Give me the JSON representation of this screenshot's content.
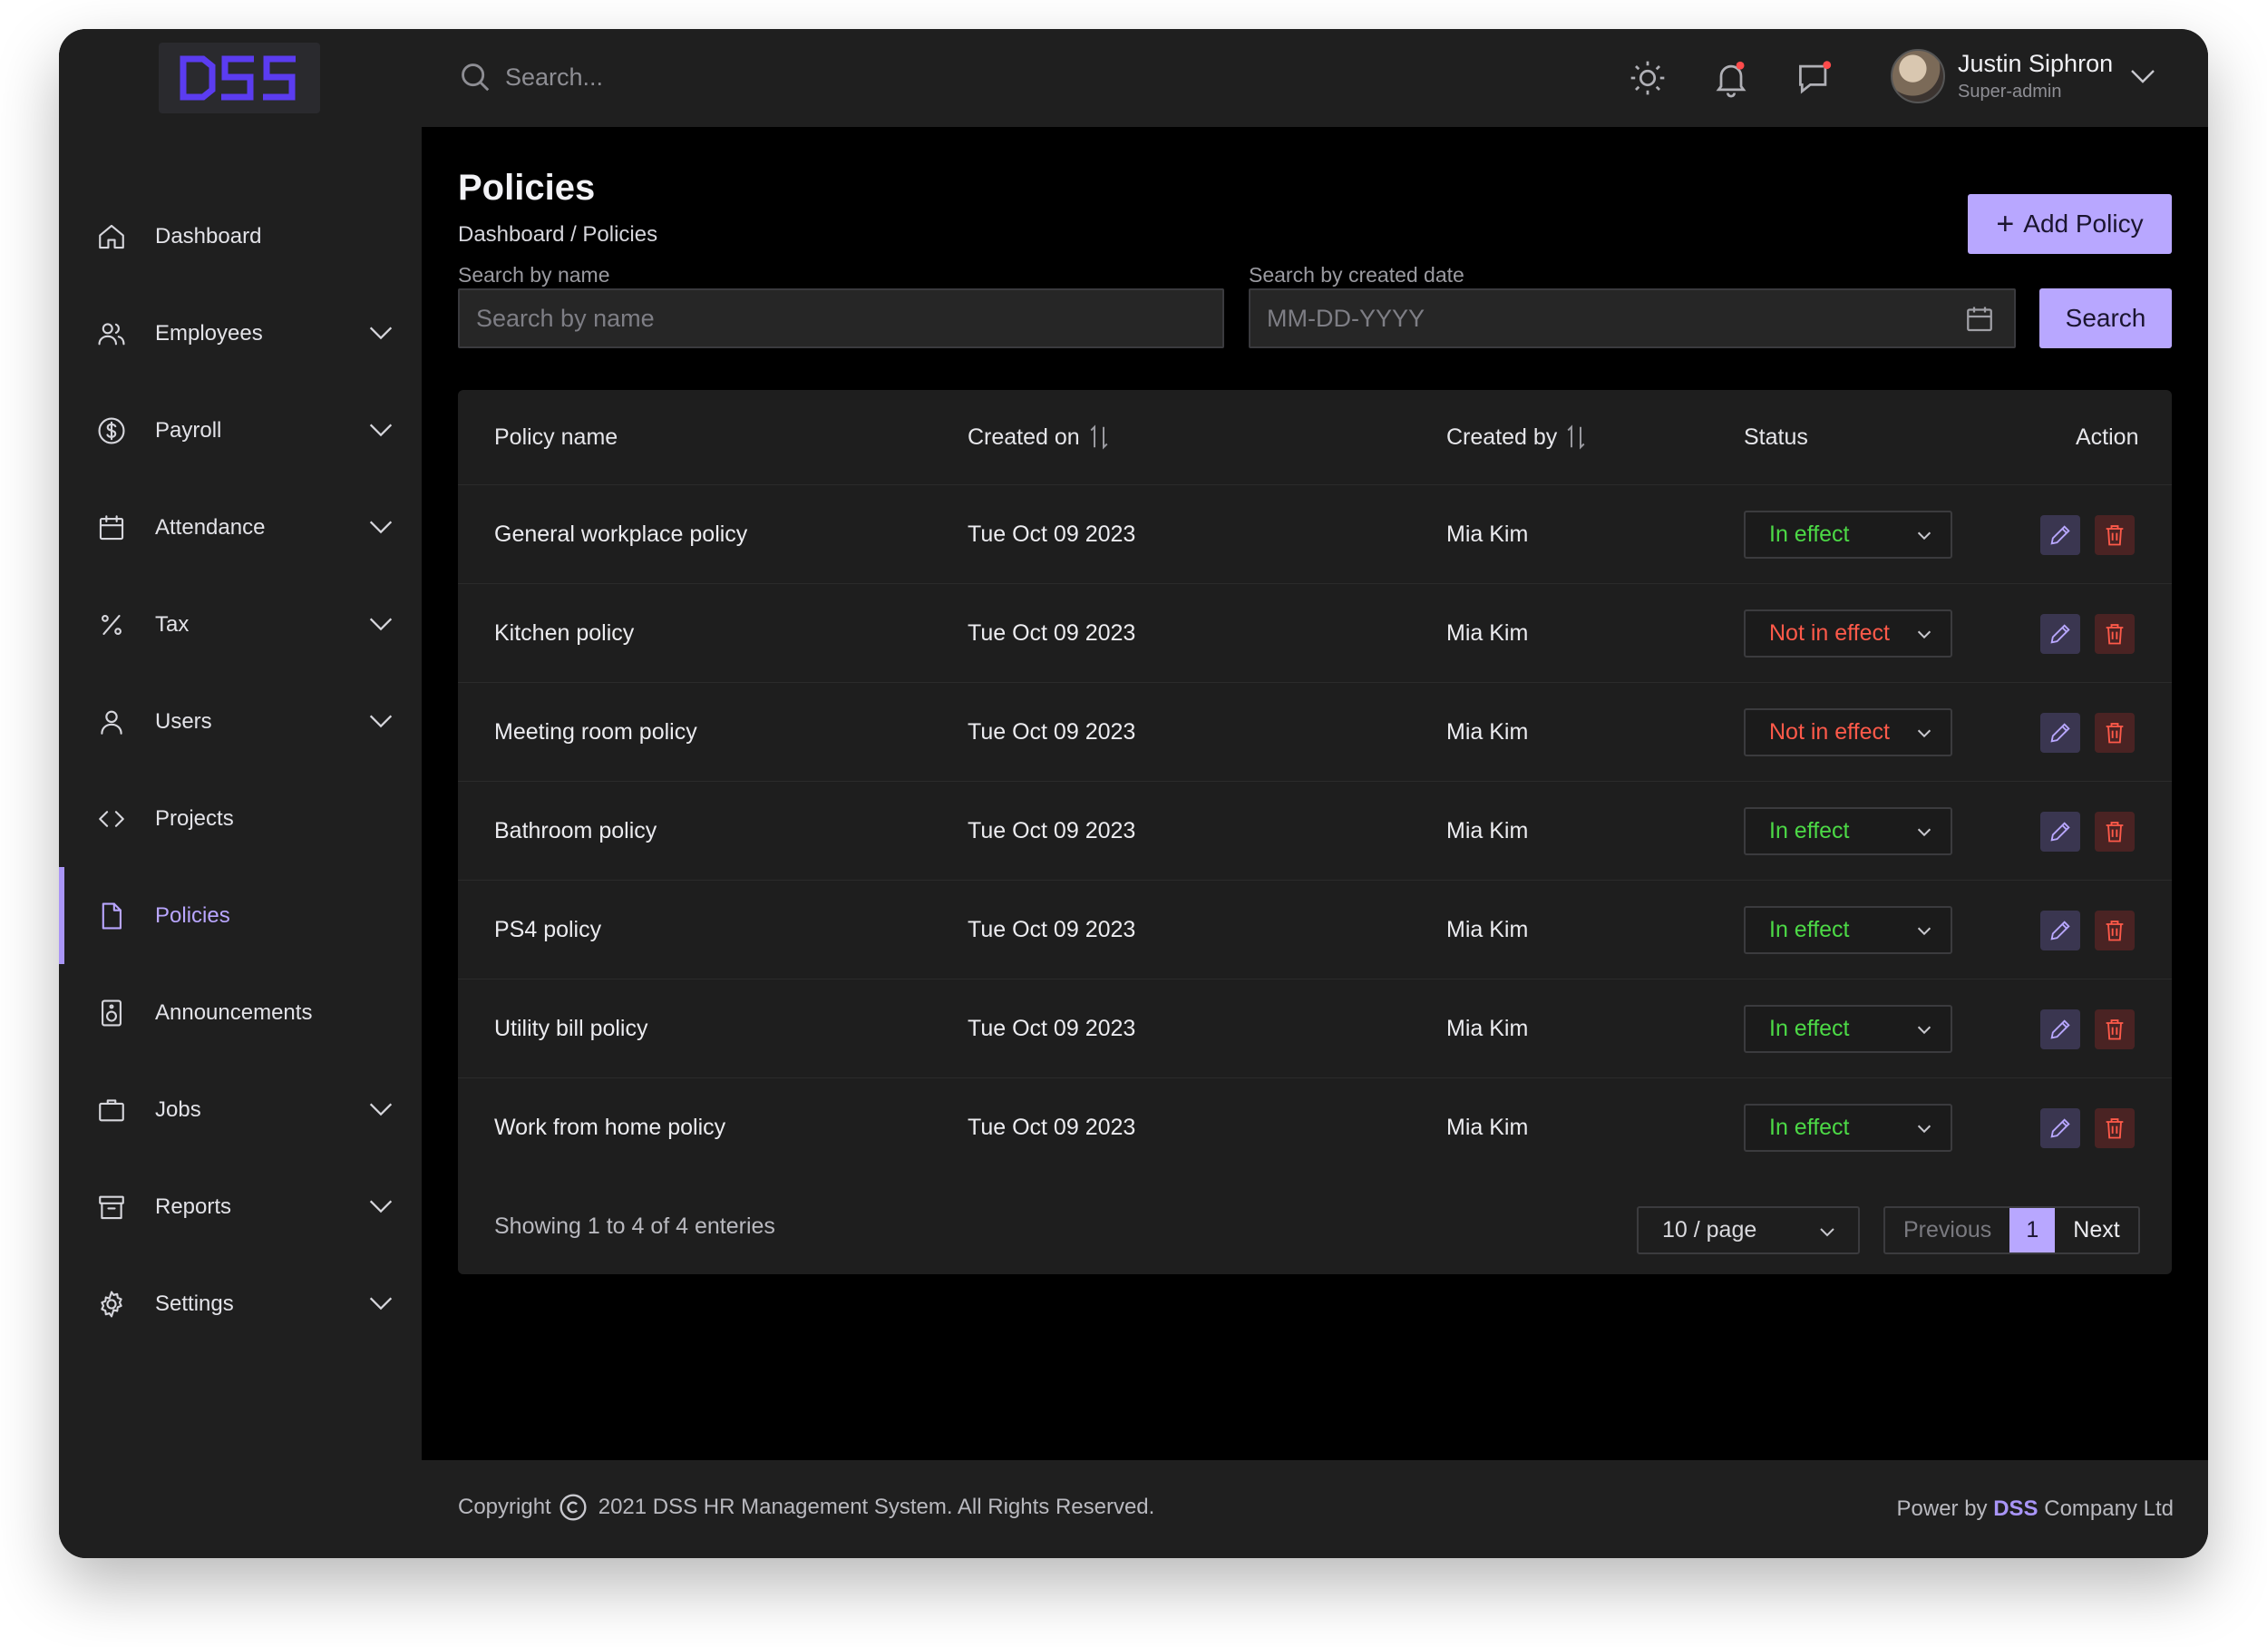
{
  "brand": {
    "logo_text": "DSS"
  },
  "sidebar": {
    "items": [
      {
        "label": "Dashboard",
        "icon": "home-icon",
        "expandable": false
      },
      {
        "label": "Employees",
        "icon": "users-icon",
        "expandable": true
      },
      {
        "label": "Payroll",
        "icon": "dollar-icon",
        "expandable": true
      },
      {
        "label": "Attendance",
        "icon": "calendar-icon",
        "expandable": true
      },
      {
        "label": "Tax",
        "icon": "percent-icon",
        "expandable": true
      },
      {
        "label": "Users",
        "icon": "user-icon",
        "expandable": true
      },
      {
        "label": "Projects",
        "icon": "code-icon",
        "expandable": false
      },
      {
        "label": "Policies",
        "icon": "file-icon",
        "expandable": false,
        "active": true
      },
      {
        "label": "Announcements",
        "icon": "speaker-icon",
        "expandable": false
      },
      {
        "label": "Jobs",
        "icon": "briefcase-icon",
        "expandable": true
      },
      {
        "label": "Reports",
        "icon": "archive-icon",
        "expandable": true
      },
      {
        "label": "Settings",
        "icon": "gear-icon",
        "expandable": true
      }
    ]
  },
  "header": {
    "search_placeholder": "Search...",
    "user": {
      "name": "Justin Siphron",
      "role": "Super-admin"
    }
  },
  "page": {
    "title": "Policies",
    "breadcrumb": "Dashboard / Policies",
    "add_button": "Add Policy"
  },
  "filters": {
    "name_label": "Search by name",
    "name_placeholder": "Search by name",
    "date_label": "Search by created date",
    "date_placeholder": "MM-DD-YYYY",
    "search_button": "Search"
  },
  "table": {
    "columns": [
      "Policy name",
      "Created on",
      "Created by",
      "Status",
      "Action"
    ],
    "rows": [
      {
        "name": "General workplace policy",
        "created_on": "Tue Oct 09 2023",
        "created_by": "Mia Kim",
        "status": "In effect"
      },
      {
        "name": "Kitchen policy",
        "created_on": "Tue Oct 09 2023",
        "created_by": "Mia Kim",
        "status": "Not in effect"
      },
      {
        "name": "Meeting room policy",
        "created_on": "Tue Oct 09 2023",
        "created_by": "Mia Kim",
        "status": "Not in effect"
      },
      {
        "name": "Bathroom policy",
        "created_on": "Tue Oct 09 2023",
        "created_by": "Mia Kim",
        "status": "In effect"
      },
      {
        "name": "PS4 policy",
        "created_on": "Tue Oct 09 2023",
        "created_by": "Mia Kim",
        "status": "In effect"
      },
      {
        "name": "Utility bill policy",
        "created_on": "Tue Oct 09 2023",
        "created_by": "Mia Kim",
        "status": "In effect"
      },
      {
        "name": "Work from home policy",
        "created_on": "Tue Oct 09 2023",
        "created_by": "Mia Kim",
        "status": "In effect"
      }
    ],
    "showing": "Showing 1 to 4 of 4 enteries",
    "page_size": "10 / page",
    "prev": "Previous",
    "current_page": "1",
    "next": "Next"
  },
  "footer": {
    "copyright_prefix": "Copyright",
    "copyright_text": "2021 DSS HR Management System. All Rights Reserved.",
    "power_prefix": "Power by",
    "power_brand": "DSS",
    "power_suffix": "Company Ltd"
  },
  "colors": {
    "accent": "#b8a7ff",
    "in_effect": "#4cd946",
    "not_in_effect": "#ff5a4a",
    "sidebar_bg": "#1f1f1f",
    "main_bg": "#000000"
  }
}
